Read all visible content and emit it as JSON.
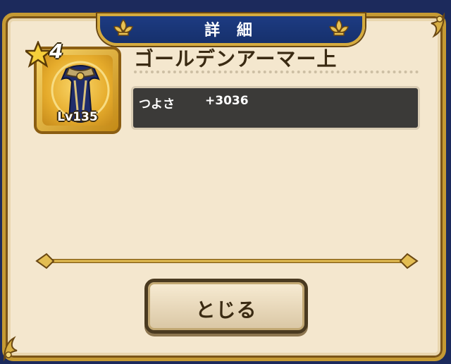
{
  "dialog": {
    "title": "詳 細",
    "item": {
      "name": "ゴールデンアーマー上",
      "rank": "4",
      "level": "Lv135",
      "icon": "golden-armor-icon"
    },
    "stats": [
      {
        "label": "つよさ",
        "value": "+3036"
      }
    ],
    "close_label": "とじる"
  },
  "colors": {
    "title_bar": "#1d3b82",
    "gold": "#c59a33",
    "panel": "#f4e7ce",
    "stat_box": "#3b3a38"
  }
}
